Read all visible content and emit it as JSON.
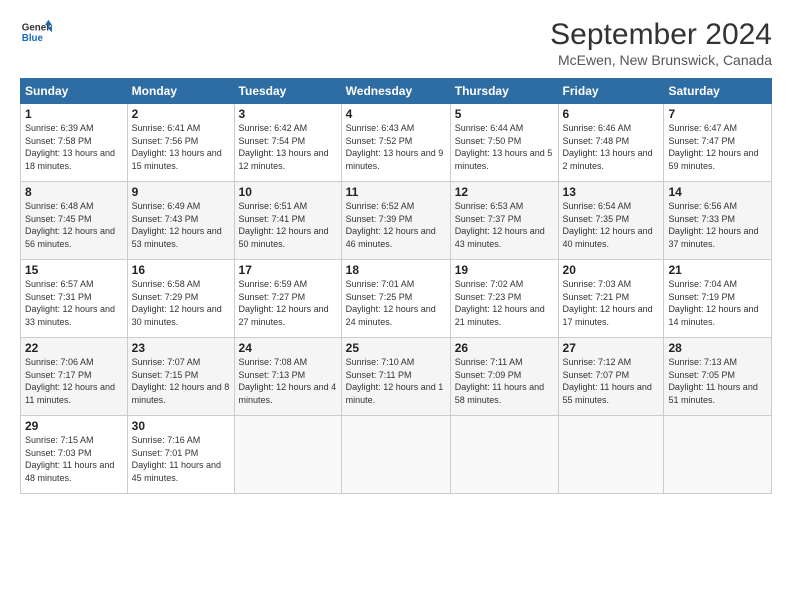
{
  "header": {
    "logo_line1": "General",
    "logo_line2": "Blue",
    "title": "September 2024",
    "location": "McEwen, New Brunswick, Canada"
  },
  "days_of_week": [
    "Sunday",
    "Monday",
    "Tuesday",
    "Wednesday",
    "Thursday",
    "Friday",
    "Saturday"
  ],
  "weeks": [
    [
      {
        "day": "1",
        "sunrise": "Sunrise: 6:39 AM",
        "sunset": "Sunset: 7:58 PM",
        "daylight": "Daylight: 13 hours and 18 minutes."
      },
      {
        "day": "2",
        "sunrise": "Sunrise: 6:41 AM",
        "sunset": "Sunset: 7:56 PM",
        "daylight": "Daylight: 13 hours and 15 minutes."
      },
      {
        "day": "3",
        "sunrise": "Sunrise: 6:42 AM",
        "sunset": "Sunset: 7:54 PM",
        "daylight": "Daylight: 13 hours and 12 minutes."
      },
      {
        "day": "4",
        "sunrise": "Sunrise: 6:43 AM",
        "sunset": "Sunset: 7:52 PM",
        "daylight": "Daylight: 13 hours and 9 minutes."
      },
      {
        "day": "5",
        "sunrise": "Sunrise: 6:44 AM",
        "sunset": "Sunset: 7:50 PM",
        "daylight": "Daylight: 13 hours and 5 minutes."
      },
      {
        "day": "6",
        "sunrise": "Sunrise: 6:46 AM",
        "sunset": "Sunset: 7:48 PM",
        "daylight": "Daylight: 13 hours and 2 minutes."
      },
      {
        "day": "7",
        "sunrise": "Sunrise: 6:47 AM",
        "sunset": "Sunset: 7:47 PM",
        "daylight": "Daylight: 12 hours and 59 minutes."
      }
    ],
    [
      {
        "day": "8",
        "sunrise": "Sunrise: 6:48 AM",
        "sunset": "Sunset: 7:45 PM",
        "daylight": "Daylight: 12 hours and 56 minutes."
      },
      {
        "day": "9",
        "sunrise": "Sunrise: 6:49 AM",
        "sunset": "Sunset: 7:43 PM",
        "daylight": "Daylight: 12 hours and 53 minutes."
      },
      {
        "day": "10",
        "sunrise": "Sunrise: 6:51 AM",
        "sunset": "Sunset: 7:41 PM",
        "daylight": "Daylight: 12 hours and 50 minutes."
      },
      {
        "day": "11",
        "sunrise": "Sunrise: 6:52 AM",
        "sunset": "Sunset: 7:39 PM",
        "daylight": "Daylight: 12 hours and 46 minutes."
      },
      {
        "day": "12",
        "sunrise": "Sunrise: 6:53 AM",
        "sunset": "Sunset: 7:37 PM",
        "daylight": "Daylight: 12 hours and 43 minutes."
      },
      {
        "day": "13",
        "sunrise": "Sunrise: 6:54 AM",
        "sunset": "Sunset: 7:35 PM",
        "daylight": "Daylight: 12 hours and 40 minutes."
      },
      {
        "day": "14",
        "sunrise": "Sunrise: 6:56 AM",
        "sunset": "Sunset: 7:33 PM",
        "daylight": "Daylight: 12 hours and 37 minutes."
      }
    ],
    [
      {
        "day": "15",
        "sunrise": "Sunrise: 6:57 AM",
        "sunset": "Sunset: 7:31 PM",
        "daylight": "Daylight: 12 hours and 33 minutes."
      },
      {
        "day": "16",
        "sunrise": "Sunrise: 6:58 AM",
        "sunset": "Sunset: 7:29 PM",
        "daylight": "Daylight: 12 hours and 30 minutes."
      },
      {
        "day": "17",
        "sunrise": "Sunrise: 6:59 AM",
        "sunset": "Sunset: 7:27 PM",
        "daylight": "Daylight: 12 hours and 27 minutes."
      },
      {
        "day": "18",
        "sunrise": "Sunrise: 7:01 AM",
        "sunset": "Sunset: 7:25 PM",
        "daylight": "Daylight: 12 hours and 24 minutes."
      },
      {
        "day": "19",
        "sunrise": "Sunrise: 7:02 AM",
        "sunset": "Sunset: 7:23 PM",
        "daylight": "Daylight: 12 hours and 21 minutes."
      },
      {
        "day": "20",
        "sunrise": "Sunrise: 7:03 AM",
        "sunset": "Sunset: 7:21 PM",
        "daylight": "Daylight: 12 hours and 17 minutes."
      },
      {
        "day": "21",
        "sunrise": "Sunrise: 7:04 AM",
        "sunset": "Sunset: 7:19 PM",
        "daylight": "Daylight: 12 hours and 14 minutes."
      }
    ],
    [
      {
        "day": "22",
        "sunrise": "Sunrise: 7:06 AM",
        "sunset": "Sunset: 7:17 PM",
        "daylight": "Daylight: 12 hours and 11 minutes."
      },
      {
        "day": "23",
        "sunrise": "Sunrise: 7:07 AM",
        "sunset": "Sunset: 7:15 PM",
        "daylight": "Daylight: 12 hours and 8 minutes."
      },
      {
        "day": "24",
        "sunrise": "Sunrise: 7:08 AM",
        "sunset": "Sunset: 7:13 PM",
        "daylight": "Daylight: 12 hours and 4 minutes."
      },
      {
        "day": "25",
        "sunrise": "Sunrise: 7:10 AM",
        "sunset": "Sunset: 7:11 PM",
        "daylight": "Daylight: 12 hours and 1 minute."
      },
      {
        "day": "26",
        "sunrise": "Sunrise: 7:11 AM",
        "sunset": "Sunset: 7:09 PM",
        "daylight": "Daylight: 11 hours and 58 minutes."
      },
      {
        "day": "27",
        "sunrise": "Sunrise: 7:12 AM",
        "sunset": "Sunset: 7:07 PM",
        "daylight": "Daylight: 11 hours and 55 minutes."
      },
      {
        "day": "28",
        "sunrise": "Sunrise: 7:13 AM",
        "sunset": "Sunset: 7:05 PM",
        "daylight": "Daylight: 11 hours and 51 minutes."
      }
    ],
    [
      {
        "day": "29",
        "sunrise": "Sunrise: 7:15 AM",
        "sunset": "Sunset: 7:03 PM",
        "daylight": "Daylight: 11 hours and 48 minutes."
      },
      {
        "day": "30",
        "sunrise": "Sunrise: 7:16 AM",
        "sunset": "Sunset: 7:01 PM",
        "daylight": "Daylight: 11 hours and 45 minutes."
      },
      null,
      null,
      null,
      null,
      null
    ]
  ]
}
